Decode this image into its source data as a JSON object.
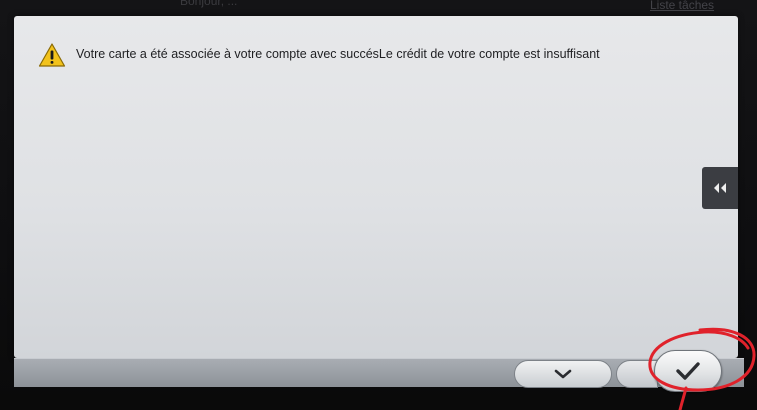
{
  "background": {
    "top_left_text": "Bonjour, ...",
    "top_right_text": "Liste tâches"
  },
  "dialog": {
    "message": "Votre carte a été associée à votre compte avec succésLe crédit de votre compte est insuffisant",
    "icon": "warning-icon"
  },
  "footer": {
    "scroll_icon": "chevron-down-icon",
    "ok_icon": "checkmark-icon"
  },
  "side_tab": {
    "icon": "double-chevron-left-icon"
  },
  "colors": {
    "warning_fill": "#f2c21b",
    "annotation_red": "#e0222b"
  }
}
